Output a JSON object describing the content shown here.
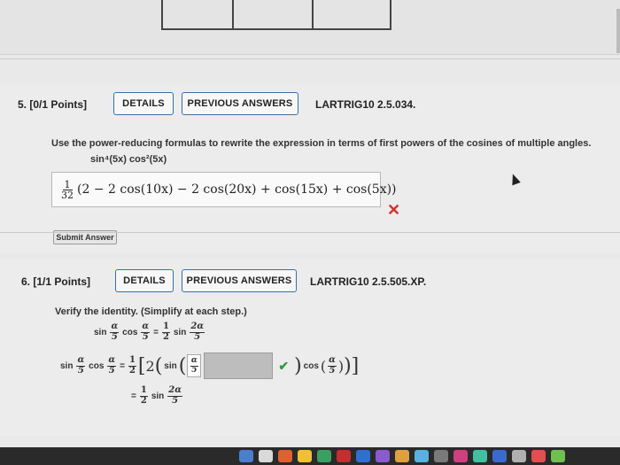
{
  "q5": {
    "number": "5. [0/1 Points]",
    "details": "DETAILS",
    "previous_answers": "PREVIOUS ANSWERS",
    "course_code": "LARTRIG10 2.5.034.",
    "instruction": "Use the power-reducing formulas to rewrite the expression in terms of first powers of the cosines of multiple angles.",
    "expression": "sin⁴(5x) cos²(5x)",
    "answer": {
      "coef_num": "1",
      "coef_den": "32",
      "body": "(2 − 2 cos(10x) − 2 cos(20x) + cos(15x) + cos(5x))"
    },
    "status_icon": "x-mark-icon",
    "submit": "Submit Answer"
  },
  "q6": {
    "number": "6. [1/1 Points]",
    "details": "DETAILS",
    "previous_answers": "PREVIOUS ANSWERS",
    "course_code": "LARTRIG10 2.5.505.XP.",
    "instruction": "Verify the identity. (Simplify at each step.)",
    "status_icon": "checkmark-icon"
  },
  "colors": {
    "button_border": "#3b6ea5",
    "error": "#d43030",
    "success": "#2e9a3a"
  }
}
